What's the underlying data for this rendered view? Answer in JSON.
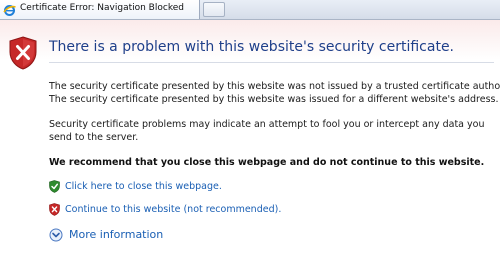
{
  "tab": {
    "title": "Certificate Error: Navigation Blocked",
    "icon": "ie-logo-icon"
  },
  "page": {
    "heading": "There is a problem with this website's security certificate.",
    "paragraph1": "The security certificate presented by this website was not issued by a trusted certificate authority.",
    "paragraph2": "The security certificate presented by this website was issued for a different website's address.",
    "paragraph3": "Security certificate problems may indicate an attempt to fool you or intercept any data you send to the server.",
    "recommendation": "We recommend that you close this webpage and do not continue to this website.",
    "close_link": "Click here to close this webpage.",
    "continue_link": "Continue to this website (not recommended).",
    "more_info": "More information"
  },
  "colors": {
    "heading": "#1f3f8a",
    "link": "#1a5fb4",
    "error_shield": "#c62828",
    "safe_shield": "#2e8b2e"
  }
}
